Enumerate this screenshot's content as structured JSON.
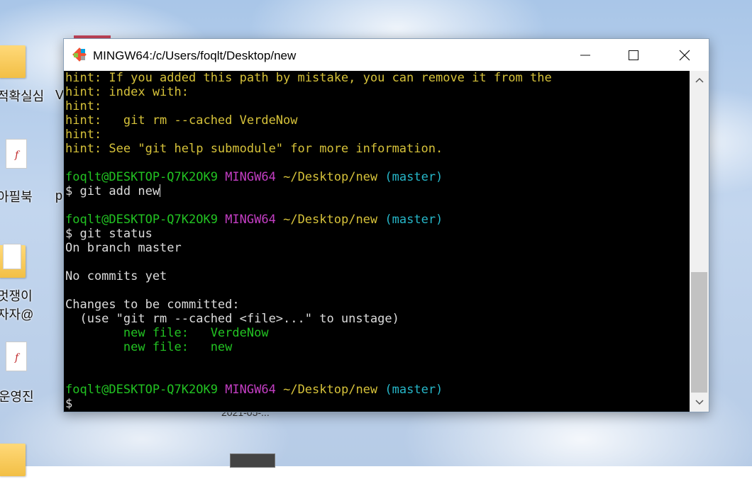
{
  "desktop": {
    "labels": {
      "l1": "적확실심",
      "l1b": "V",
      "l2": "아필북",
      "l2b": "p",
      "l3": "멋쟁이",
      "l4": "자자@",
      "l5": "운영진",
      "date_fragment": "2021-05-..."
    }
  },
  "window": {
    "title": "MINGW64:/c/Users/foqlt/Desktop/new",
    "icon": "git-bash-icon",
    "buttons": {
      "minimize": "minimize-icon",
      "maximize": "maximize-icon",
      "close": "close-icon"
    }
  },
  "terminal": {
    "hint1": "hint: If you added this path by mistake, you can remove it from the",
    "hint2": "hint: index with:",
    "hint3": "hint:",
    "hint4": "hint:   git rm --cached VerdeNow",
    "hint5": "hint:",
    "hint6": "hint: See \"git help submodule\" for more information.",
    "prompt_user": "foqlt@DESKTOP-Q7K2OK9",
    "prompt_env": "MINGW64",
    "prompt_path": "~/Desktop/new",
    "prompt_branch": "(master)",
    "cmd1": "$ git add new",
    "cmd2": "$ git status",
    "out_branch": "On branch master",
    "out_nocommits": "No commits yet",
    "out_changes": "Changes to be committed:",
    "out_use": "  (use \"git rm --cached <file>...\" to unstage)",
    "out_new1": "        new file:   VerdeNow",
    "out_new2": "        new file:   new",
    "prompt_symbol": "$"
  },
  "colors": {
    "hint": "#d6c23a",
    "user": "#22c322",
    "mingw": "#c43ec4",
    "branch": "#26b7c9",
    "background": "#000000"
  }
}
